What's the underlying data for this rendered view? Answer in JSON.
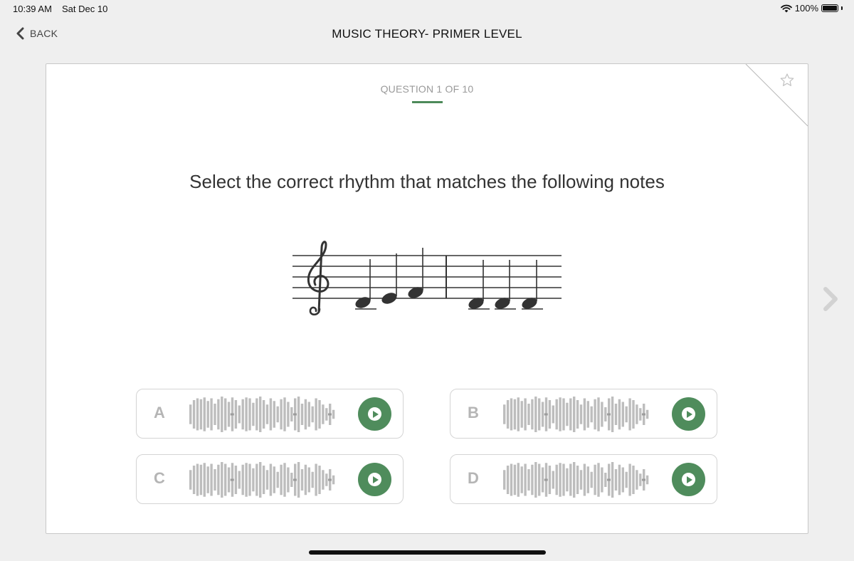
{
  "status_bar": {
    "time": "10:39 AM",
    "date": "Sat Dec 10",
    "battery": "100%",
    "battery_level": 1.0
  },
  "nav": {
    "back_label": "BACK",
    "title": "MUSIC THEORY- PRIMER LEVEL"
  },
  "question": {
    "counter": "QUESTION 1 OF 10",
    "prompt": "Select the correct rhythm that matches the following notes"
  },
  "answers": [
    {
      "letter": "A"
    },
    {
      "letter": "B"
    },
    {
      "letter": "C"
    },
    {
      "letter": "D"
    }
  ],
  "icons": {
    "back": "chevron-left-icon",
    "favorite": "star-outline-icon",
    "play": "play-icon",
    "next": "chevron-right-icon",
    "wifi": "wifi-icon",
    "battery": "battery-icon"
  },
  "colors": {
    "accent": "#4f8c5c",
    "letter": "#b5b5b5",
    "waveform": "#bdbdbd"
  }
}
